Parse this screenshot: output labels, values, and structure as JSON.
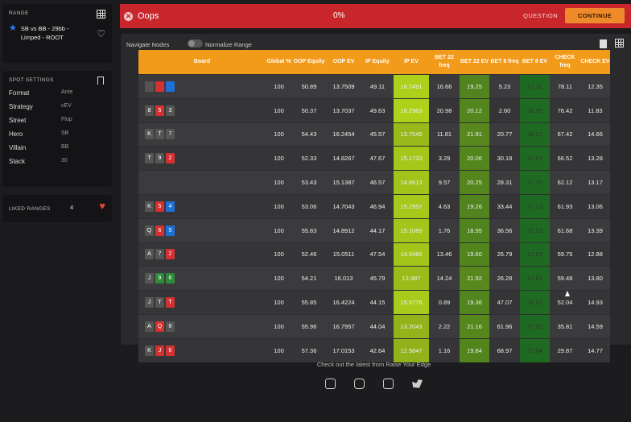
{
  "range": {
    "title": "RANGE",
    "line1": "SB vs BB - 29bb -",
    "line2": "Limped - ROOT"
  },
  "spot": {
    "title": "SPOT SETTINGS",
    "rows": [
      {
        "k": "Format",
        "v": "Ante"
      },
      {
        "k": "Strategy",
        "v": "cEV"
      },
      {
        "k": "Street",
        "v": "Flop"
      },
      {
        "k": "Hero",
        "v": "SB"
      },
      {
        "k": "Villain",
        "v": "BB"
      },
      {
        "k": "Stack",
        "v": "30"
      }
    ]
  },
  "liked": {
    "title": "LIKED RANGES",
    "count": "4"
  },
  "topbar": {
    "oops": "Oops",
    "percent": "0%",
    "question": "QUESTION",
    "continue": "CONTINUE"
  },
  "nav": {
    "label": "Navigate Nodes",
    "normalize": "Normalize Range"
  },
  "table": {
    "headers": [
      "Board",
      "Global %",
      "OOP Equity",
      "OOP EV",
      "IP Equity",
      "IP EV",
      "BET 22 freq",
      "BET 22 EV",
      "BET 8 freq",
      "BET 8 EV",
      "CHECK freq",
      "CHECK EV"
    ],
    "rows": [
      {
        "cards": [
          {
            "r": "",
            "s": "gray"
          },
          {
            "r": "",
            "s": "red"
          },
          {
            "r": "",
            "s": "blue"
          }
        ],
        "v": [
          "100",
          "50.89",
          "13.7509",
          "49.11",
          "16.2491",
          "16.66",
          "19.25",
          "5.23",
          "17.11",
          "78.11",
          "12.35"
        ]
      },
      {
        "cards": [
          {
            "r": "8",
            "s": "gray"
          },
          {
            "r": "5",
            "s": "red"
          },
          {
            "r": "3",
            "s": "gray"
          }
        ],
        "v": [
          "100",
          "50.37",
          "13.7037",
          "49.63",
          "16.2963",
          "20.98",
          "20.12",
          "2.60",
          "16.96",
          "76.42",
          "11.83"
        ]
      },
      {
        "cards": [
          {
            "r": "K",
            "s": "gray"
          },
          {
            "r": "T",
            "s": "gray"
          },
          {
            "r": "7",
            "s": "gray"
          }
        ],
        "v": [
          "100",
          "54.43",
          "16.2454",
          "45.57",
          "13.7546",
          "11.81",
          "21.91",
          "20.77",
          "18.17",
          "67.42",
          "14.66"
        ]
      },
      {
        "cards": [
          {
            "r": "T",
            "s": "gray"
          },
          {
            "r": "9",
            "s": "gray"
          },
          {
            "r": "2",
            "s": "red"
          }
        ],
        "v": [
          "100",
          "52.33",
          "14.8267",
          "47.67",
          "15.1733",
          "3.29",
          "20.06",
          "30.18",
          "17.67",
          "66.52",
          "13.28"
        ]
      },
      {
        "cards": [],
        "v": [
          "100",
          "53.43",
          "15.1387",
          "46.57",
          "14.8613",
          "9.57",
          "20.25",
          "28.31",
          "17.72",
          "62.12",
          "13.17"
        ]
      },
      {
        "cards": [
          {
            "r": "K",
            "s": "gray"
          },
          {
            "r": "5",
            "s": "red"
          },
          {
            "r": "4",
            "s": "blue"
          }
        ],
        "v": [
          "100",
          "53.06",
          "14.7043",
          "46.94",
          "15.2957",
          "4.63",
          "19.26",
          "33.44",
          "17.12",
          "61.93",
          "13.06"
        ]
      },
      {
        "cards": [
          {
            "r": "Q",
            "s": "gray"
          },
          {
            "r": "6",
            "s": "red"
          },
          {
            "r": "5",
            "s": "blue"
          }
        ],
        "v": [
          "100",
          "55.83",
          "14.8912",
          "44.17",
          "15.1089",
          "1.76",
          "18.95",
          "36.56",
          "17.23",
          "61.68",
          "13.39"
        ]
      },
      {
        "cards": [
          {
            "r": "A",
            "s": "gray"
          },
          {
            "r": "7",
            "s": "gray"
          },
          {
            "r": "2",
            "s": "red"
          }
        ],
        "v": [
          "100",
          "52.46",
          "15.0511",
          "47.54",
          "14.9489",
          "13.46",
          "19.60",
          "26.79",
          "17.62",
          "59.75",
          "12.88"
        ]
      },
      {
        "cards": [
          {
            "r": "J",
            "s": "gray"
          },
          {
            "r": "9",
            "s": "green"
          },
          {
            "r": "6",
            "s": "green"
          }
        ],
        "v": [
          "100",
          "54.21",
          "16.013",
          "45.79",
          "13.987",
          "14.24",
          "21.92",
          "26.28",
          "17.81",
          "59.48",
          "13.80"
        ]
      },
      {
        "cards": [
          {
            "r": "J",
            "s": "gray"
          },
          {
            "r": "T",
            "s": "gray"
          },
          {
            "r": "T",
            "s": "red"
          }
        ],
        "v": [
          "100",
          "55.85",
          "16.4224",
          "44.15",
          "15.5776",
          "0.89",
          "19.36",
          "47.07",
          "18.02",
          "52.04",
          "14.93"
        ]
      },
      {
        "cards": [
          {
            "r": "A",
            "s": "gray"
          },
          {
            "r": "Q",
            "s": "red"
          },
          {
            "r": "8",
            "s": "gray"
          }
        ],
        "v": [
          "100",
          "55.96",
          "16.7957",
          "44.04",
          "13.2043",
          "2.22",
          "21.16",
          "61.96",
          "17.91",
          "35.81",
          "14.59"
        ]
      },
      {
        "cards": [
          {
            "r": "K",
            "s": "gray"
          },
          {
            "r": "J",
            "s": "red"
          },
          {
            "r": "6",
            "s": "red"
          }
        ],
        "v": [
          "100",
          "57.36",
          "17.0153",
          "42.64",
          "12.9847",
          "1.16",
          "19.84",
          "68.97",
          "17.94",
          "29.87",
          "14.77"
        ]
      }
    ]
  },
  "footer": {
    "text": "Check out the latest from Raise Your Edge"
  }
}
